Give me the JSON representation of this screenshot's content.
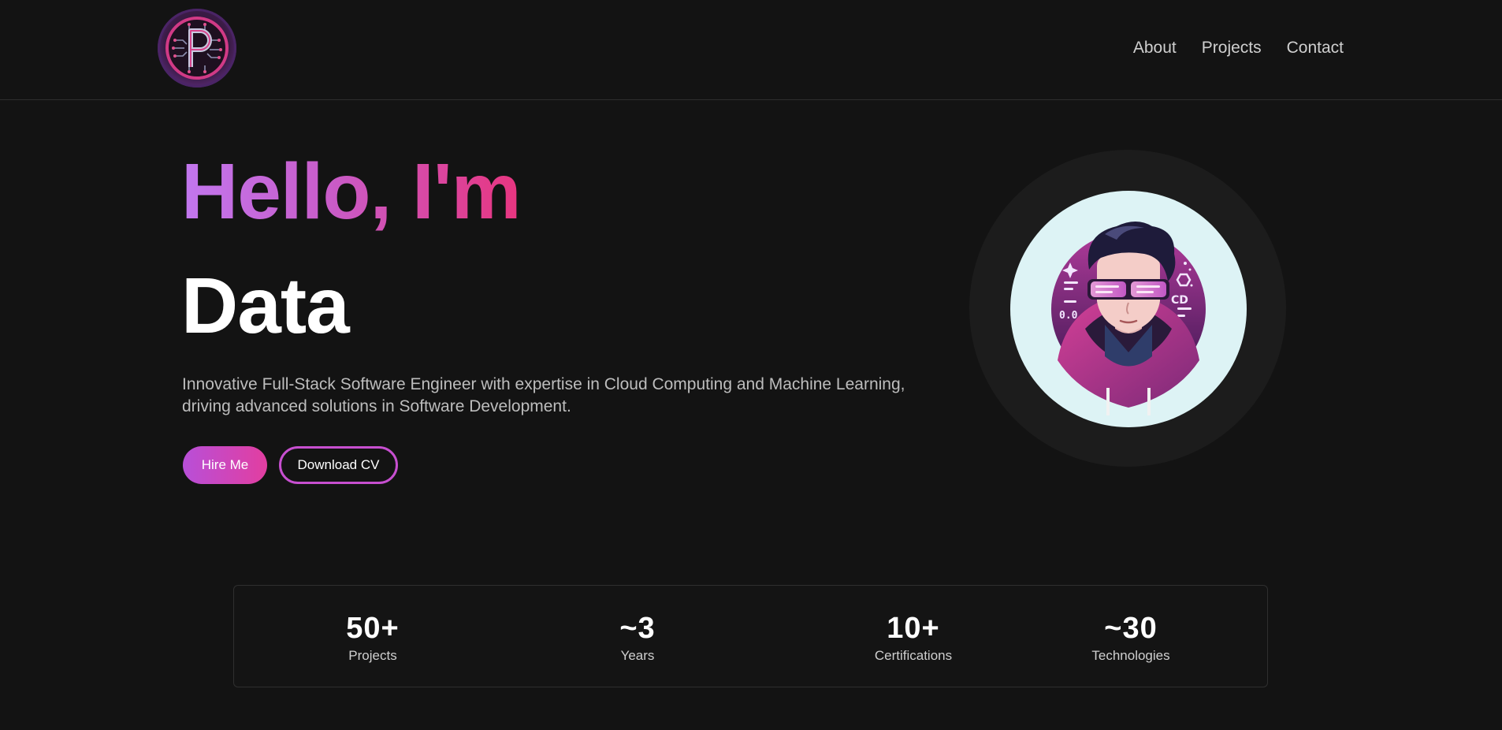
{
  "header": {
    "logo_icon": "circuit-p-logo-icon",
    "nav": [
      {
        "label": "About"
      },
      {
        "label": "Projects"
      },
      {
        "label": "Contact"
      }
    ]
  },
  "hero": {
    "greeting": "Hello, I'm",
    "role": "Data",
    "intro": "Innovative Full-Stack Software Engineer with expertise in Cloud Computing and Machine Learning, driving advanced solutions in Software Development.",
    "hire_label": "Hire Me",
    "cv_label": "Download CV",
    "avatar_icon": "developer-avatar-icon"
  },
  "stats": [
    {
      "value": "50+",
      "label": "Projects"
    },
    {
      "value": "~3",
      "label": "Years"
    },
    {
      "value": "10+",
      "label": "Certifications"
    },
    {
      "value": "~30",
      "label": "Technologies"
    }
  ],
  "colors": {
    "background": "#131313",
    "accent_purple": "#c277ef",
    "accent_pink": "#e8357f",
    "avatar_bg": "#ddf3f5"
  }
}
